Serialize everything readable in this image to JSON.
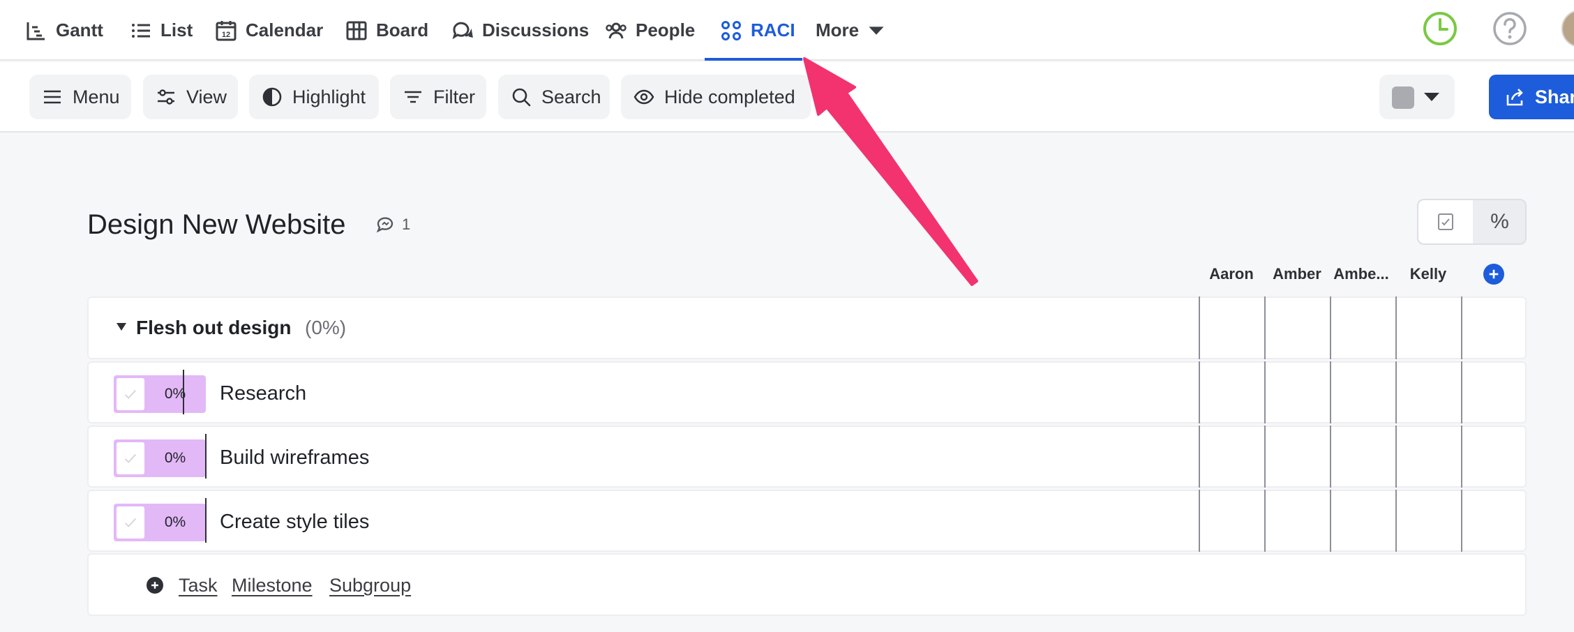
{
  "nav": {
    "tabs": [
      {
        "label": "Gantt",
        "icon": "gantt-icon"
      },
      {
        "label": "List",
        "icon": "list-icon"
      },
      {
        "label": "Calendar",
        "icon": "calendar-icon",
        "icon_text": "12"
      },
      {
        "label": "Board",
        "icon": "board-icon"
      },
      {
        "label": "Discussions",
        "icon": "discussions-icon"
      },
      {
        "label": "People",
        "icon": "people-icon"
      },
      {
        "label": "RACI",
        "icon": "raci-icon",
        "active": true
      },
      {
        "label": "More",
        "icon": "chevron-down-icon"
      }
    ],
    "active_color": "#1d5cdb",
    "right_icons": [
      "clock-icon",
      "help-icon",
      "avatar"
    ]
  },
  "toolbar": {
    "buttons": [
      {
        "label": "Menu",
        "icon": "hamburger-icon"
      },
      {
        "label": "View",
        "icon": "sliders-icon"
      },
      {
        "label": "Highlight",
        "icon": "contrast-icon"
      },
      {
        "label": "Filter",
        "icon": "filter-icon"
      },
      {
        "label": "Search",
        "icon": "search-icon"
      },
      {
        "label": "Hide completed",
        "icon": "eye-icon"
      }
    ],
    "color_picker": {
      "swatch_color": "#a9abb0",
      "icon": "chevron-down-icon"
    },
    "share_label": "Shar"
  },
  "project": {
    "title": "Design New Website",
    "comment_count": "1",
    "mode_toggle": {
      "check_icon": "checkbox-icon",
      "percent_label": "%",
      "active": "percent"
    }
  },
  "people": [
    "Aaron",
    "Amber",
    "Ambe...",
    "Kelly"
  ],
  "group": {
    "name": "Flesh out design",
    "progress": "(0%)"
  },
  "tasks": [
    {
      "name": "Research",
      "progress": "0%"
    },
    {
      "name": "Build wireframes",
      "progress": "0%"
    },
    {
      "name": "Create style tiles",
      "progress": "0%"
    }
  ],
  "add_row": {
    "task": "Task",
    "milestone": "Milestone",
    "subgroup": "Subgroup"
  },
  "annotation": {
    "type": "arrow",
    "color": "#f2336f",
    "points_to": "RACI"
  }
}
